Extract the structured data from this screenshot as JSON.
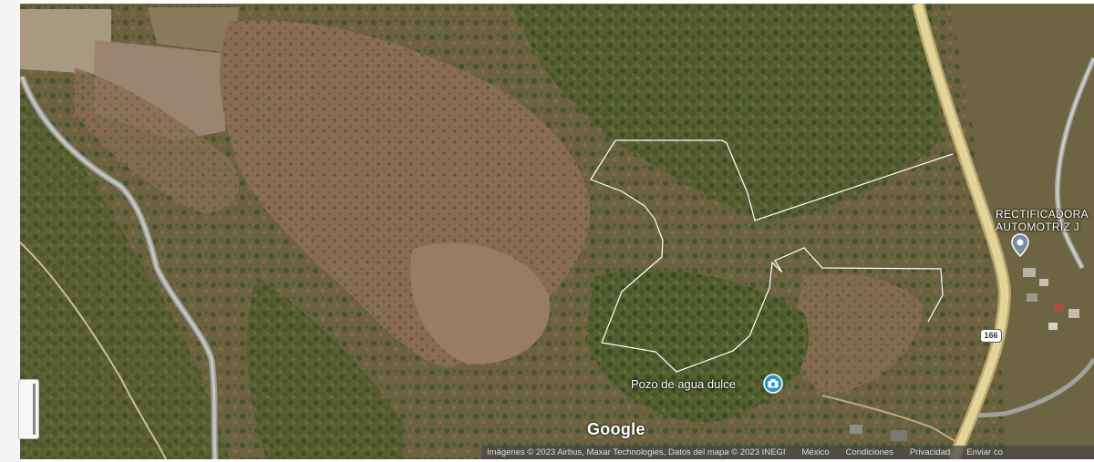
{
  "map": {
    "business_label_line1": "RECTIFICADORA",
    "business_label_line2": "AUTOMOTRIZ J",
    "poi_label": "Pozo de agua dulce",
    "route_number": "166",
    "logo_text": "Google",
    "attribution": {
      "imagery": "Imágenes © 2023 Airbus, Maxar Technologies, Datos del mapa © 2023 INEGI",
      "country": "México",
      "terms": "Condiciones",
      "privacy": "Privacidad",
      "feedback": "Enviar co"
    },
    "colors": {
      "vegetation": "#4d5a2c",
      "dry_field": "#8a6e55",
      "road": "#e3d59a",
      "boundary": "#ffffff",
      "pin": "#4a90b8"
    }
  }
}
